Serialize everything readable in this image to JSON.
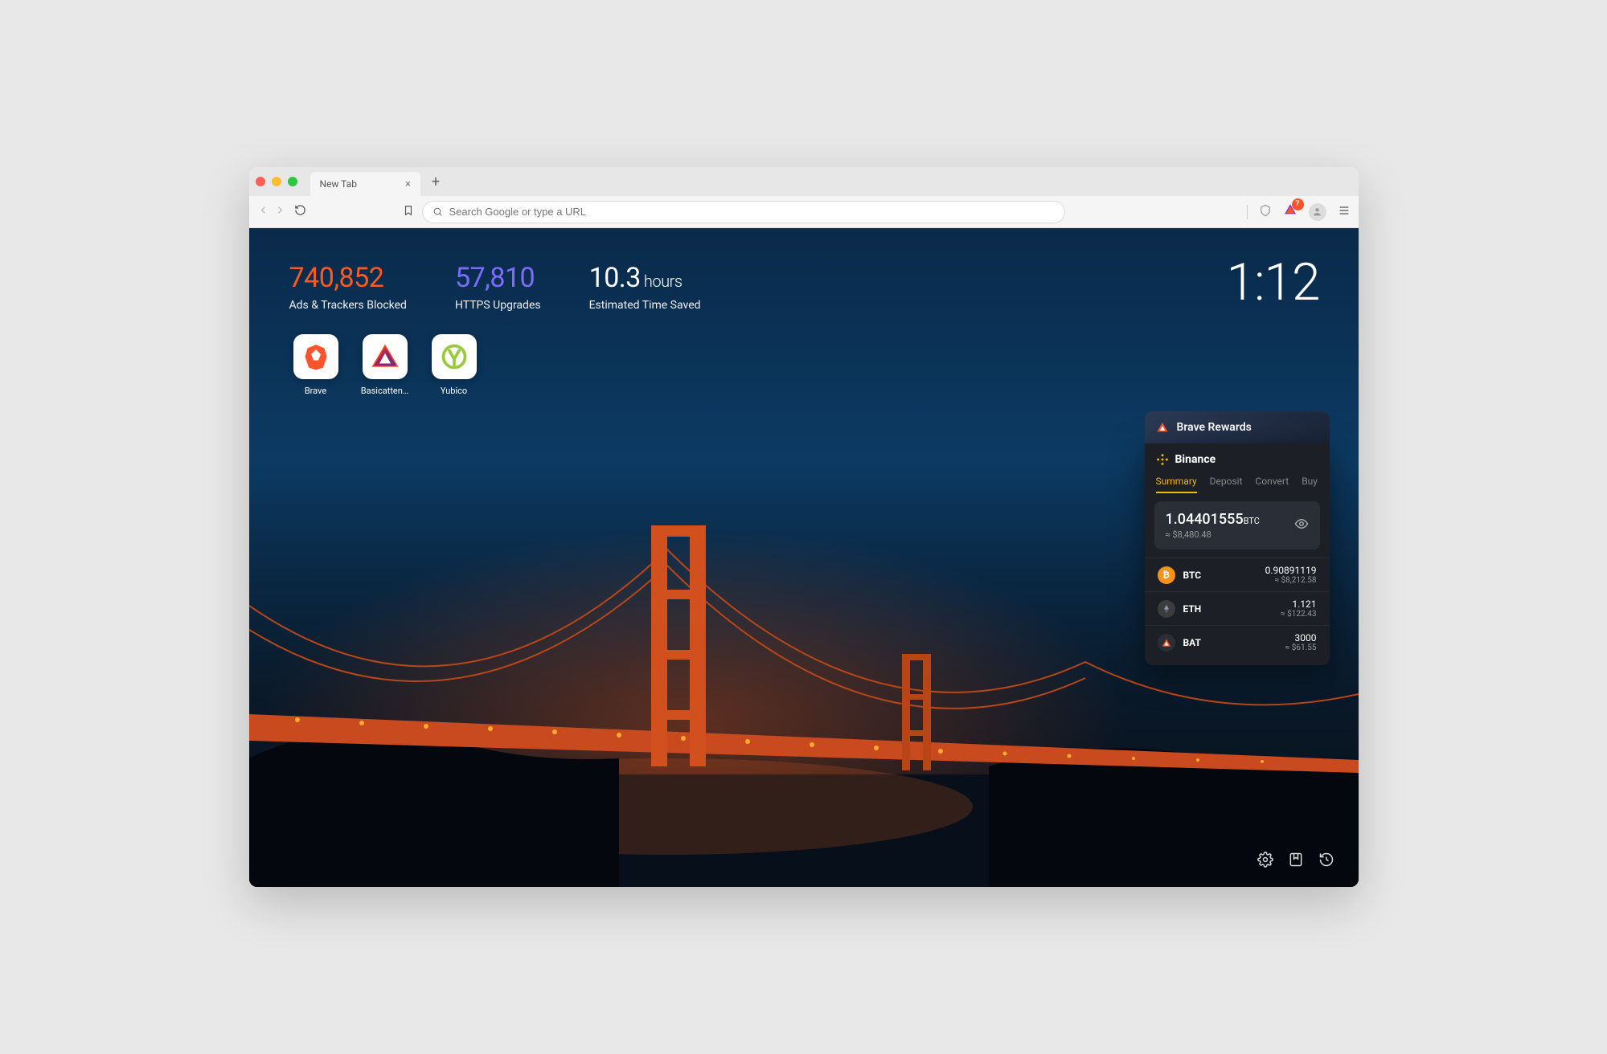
{
  "tab": {
    "title": "New Tab"
  },
  "omnibox": {
    "placeholder": "Search Google or type a URL"
  },
  "badge": {
    "count": "7"
  },
  "stats": {
    "ads": {
      "value": "740,852",
      "label": "Ads & Trackers Blocked"
    },
    "https": {
      "value": "57,810",
      "label": "HTTPS Upgrades"
    },
    "time": {
      "value": "10.3",
      "unit": "hours",
      "label": "Estimated Time Saved"
    }
  },
  "clock": "1:12",
  "topsites": [
    {
      "name": "Brave"
    },
    {
      "name": "Basicatten…"
    },
    {
      "name": "Yubico"
    }
  ],
  "rewards": {
    "title": "Brave Rewards"
  },
  "binance": {
    "title": "Binance",
    "tabs": [
      "Summary",
      "Deposit",
      "Convert",
      "Buy"
    ],
    "balance": {
      "amount": "1.04401555",
      "currency": "BTC",
      "usd": "≈ $8,480.48"
    },
    "assets": [
      {
        "sym": "BTC",
        "amt": "0.90891119",
        "usd": "≈ $8,212.58"
      },
      {
        "sym": "ETH",
        "amt": "1.121",
        "usd": "≈ $122.43"
      },
      {
        "sym": "BAT",
        "amt": "3000",
        "usd": "≈ $61.55"
      }
    ]
  }
}
